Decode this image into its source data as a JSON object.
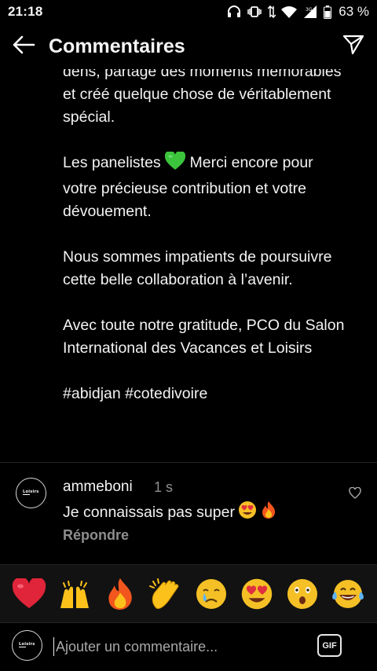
{
  "status_bar": {
    "time": "21:18",
    "battery": "63 %"
  },
  "header": {
    "title": "Commentaires",
    "back_icon": "arrow-left-icon",
    "send_icon": "paper-plane-icon"
  },
  "caption": {
    "partial_line": "dens, partage des moments",
    "para1_rest": "mémorables et créé quelque chose de véritablement spécial.",
    "para2_before_emoji": "Les panelistes",
    "para2_after_emoji": "Merci encore pour votre précieuse contribution et votre dévouement.",
    "para3": "Nous sommes impatients de poursuivre cette belle collaboration à l’avenir.",
    "para4": "Avec toute notre gratitude, PCO du Salon International des Vacances et Loisirs",
    "hashtags": "#abidjan #cotedivoire"
  },
  "comment": {
    "username": "ammeboni",
    "time": "1 s",
    "text": "Je connaissais pas super",
    "reply_label": "Répondre",
    "avatar_logo": "Loisirs"
  },
  "emoji_bar": [
    "red-heart",
    "raising-hands",
    "fire",
    "clapping-hands",
    "crying-face",
    "heart-eyes-face",
    "astonished-face",
    "tears-of-joy-face"
  ],
  "input": {
    "placeholder": "Ajouter un commentaire...",
    "gif_label": "GIF",
    "avatar_logo": "Loisirs"
  },
  "colors": {
    "background": "#000000",
    "text": "#f5f5f5",
    "muted": "#8e8e8e",
    "emoji_bar_bg": "#121212",
    "green_heart": "#3cc43c"
  }
}
